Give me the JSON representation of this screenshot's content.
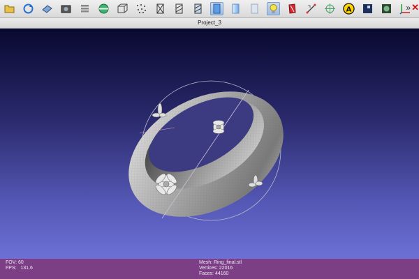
{
  "toolbar": {
    "tools": [
      {
        "name": "open-project-icon"
      },
      {
        "name": "reload-icon"
      },
      {
        "name": "import-mesh-icon"
      },
      {
        "name": "snapshot-icon"
      },
      {
        "name": "layers-icon"
      },
      {
        "name": "globe-icon"
      },
      {
        "name": "bounding-box-icon"
      },
      {
        "name": "points-icon"
      },
      {
        "name": "wireframe-icon"
      },
      {
        "name": "hidden-lines-icon"
      },
      {
        "name": "flat-lines-icon"
      },
      {
        "name": "flat-shading-icon",
        "active": true
      },
      {
        "name": "smooth-shading-icon"
      },
      {
        "name": "texture-icon"
      },
      {
        "name": "light-icon",
        "active": true
      },
      {
        "name": "red-book-icon"
      },
      {
        "name": "measure-icon"
      },
      {
        "name": "center-target-icon"
      },
      {
        "name": "annotation-icon"
      },
      {
        "name": "edit-icon"
      },
      {
        "name": "select-faces-icon"
      },
      {
        "name": "axes-icon"
      }
    ],
    "more_label": "»",
    "close_label": "✕"
  },
  "window": {
    "title": "Project_3"
  },
  "status": {
    "fov": "FOV: 60",
    "fps": "FPS:   131.6",
    "mesh": "Mesh: Ring_final.stl",
    "vertices": "Vertices: 22016",
    "faces": "Faces: 44160"
  },
  "colors": {
    "status_bar": "#7c3f86",
    "viewport_top": "#090930",
    "viewport_bottom": "#6d70d6"
  }
}
